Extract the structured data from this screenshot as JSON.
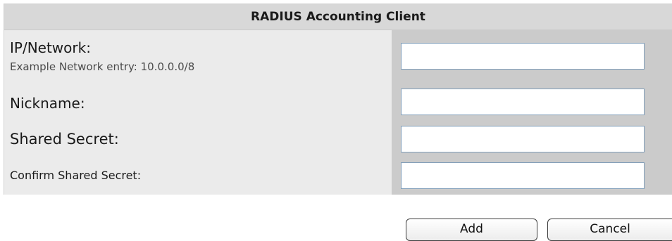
{
  "panel": {
    "title": "RADIUS Accounting Client"
  },
  "fields": {
    "ip_network": {
      "label": "IP/Network:",
      "hint": "Example Network entry: 10.0.0.0/8",
      "value": ""
    },
    "nickname": {
      "label": "Nickname:",
      "value": ""
    },
    "shared_secret": {
      "label": "Shared Secret:",
      "value": ""
    },
    "confirm_shared_secret": {
      "label": "Confirm Shared Secret:",
      "value": ""
    }
  },
  "actions": {
    "add_label": "Add",
    "cancel_label": "Cancel"
  },
  "colors": {
    "header_bg": "#d8d8d8",
    "label_bg": "#ebebeb",
    "field_bg": "#cbcbcb"
  }
}
